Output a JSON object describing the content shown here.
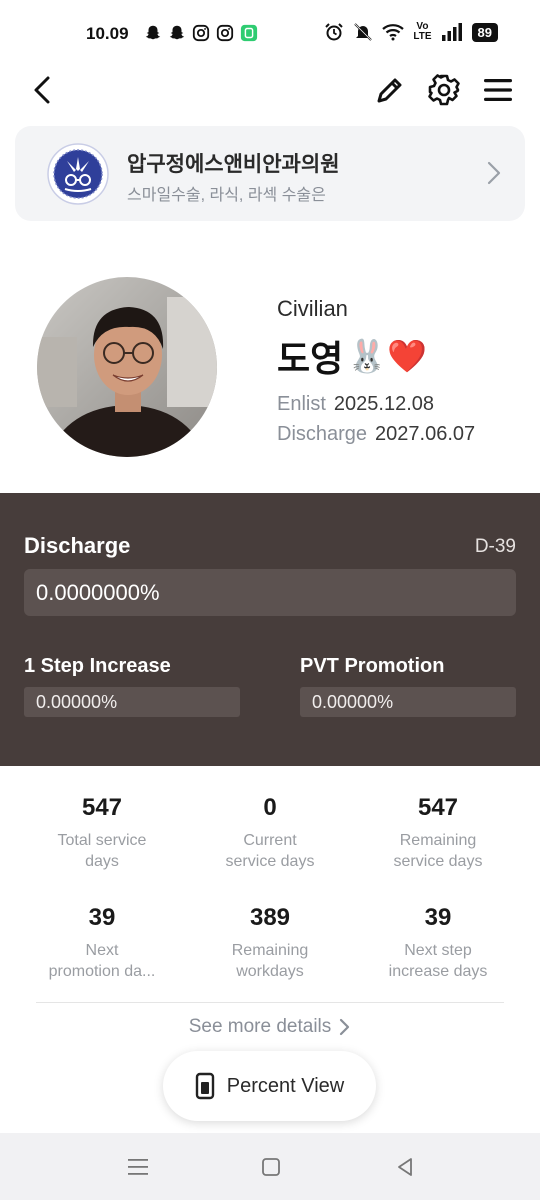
{
  "status_bar": {
    "time": "10.09",
    "battery": "89",
    "network_top": "Vo",
    "network_bottom": "LTE"
  },
  "ad": {
    "title": "압구정에스앤비안과의원",
    "subtitle": "스마일수술, 라식, 라섹 수술은"
  },
  "profile": {
    "rank": "Civilian",
    "name": "도영",
    "name_emojis": "🐰❤️",
    "enlist_label": "Enlist",
    "enlist_date": "2025.12.08",
    "discharge_label": "Discharge",
    "discharge_date": "2027.06.07"
  },
  "progress": {
    "title": "Discharge",
    "d_day": "D-39",
    "discharge_percent": "0.0000000%",
    "step_label": "1 Step Increase",
    "step_percent": "0.00000%",
    "promotion_label": "PVT Promotion",
    "promotion_percent": "0.00000%",
    "panel_color": "#473d3b"
  },
  "stats": [
    {
      "value": "547",
      "label_line1": "Total service",
      "label_line2": "days"
    },
    {
      "value": "0",
      "label_line1": "Current",
      "label_line2": "service days"
    },
    {
      "value": "547",
      "label_line1": "Remaining",
      "label_line2": "service days"
    },
    {
      "value": "39",
      "label_line1": "Next",
      "label_line2": "promotion da..."
    },
    {
      "value": "389",
      "label_line1": "Remaining",
      "label_line2": "workdays"
    },
    {
      "value": "39",
      "label_line1": "Next step",
      "label_line2": "increase days"
    }
  ],
  "actions": {
    "see_more": "See more details",
    "percent_view": "Percent View"
  },
  "icons": {
    "back": "back-arrow-icon",
    "edit": "pencil-icon",
    "settings": "gear-icon",
    "menu": "hamburger-menu-icon",
    "percent_view": "phone-battery-icon"
  }
}
